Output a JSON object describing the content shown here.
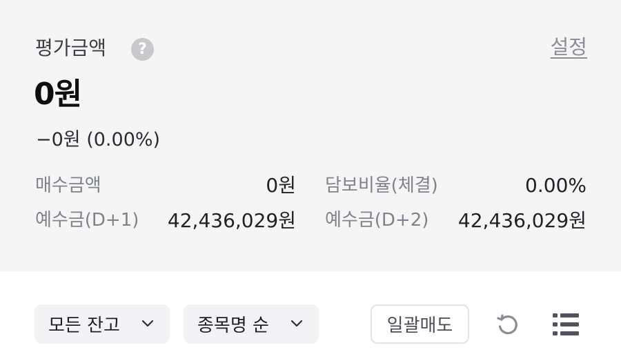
{
  "summary": {
    "eval_label": "평가금액",
    "help_icon": "question-circle-icon",
    "settings_label": "설정",
    "eval_amount": "0원",
    "eval_change": "−0원 (0.00%)",
    "stats": {
      "purchase_label": "매수금액",
      "purchase_value": "0원",
      "collateral_label": "담보비율(체결)",
      "collateral_value": "0.00%",
      "deposit_d1_label": "예수금(D+1)",
      "deposit_d1_value": "42,436,029원",
      "deposit_d2_label": "예수금(D+2)",
      "deposit_d2_value": "42,436,029원"
    }
  },
  "controls": {
    "balance_filter": "모든 잔고",
    "sort_order": "종목명 순",
    "bulk_sell_label": "일괄매도",
    "refresh_icon": "refresh-icon",
    "list_icon": "list-view-icon"
  },
  "colors": {
    "summary_bg": "#f5f5f6",
    "dropdown_bg": "#f3f3f5",
    "label_gray": "#7f828b",
    "text_dark": "#1f2126"
  }
}
